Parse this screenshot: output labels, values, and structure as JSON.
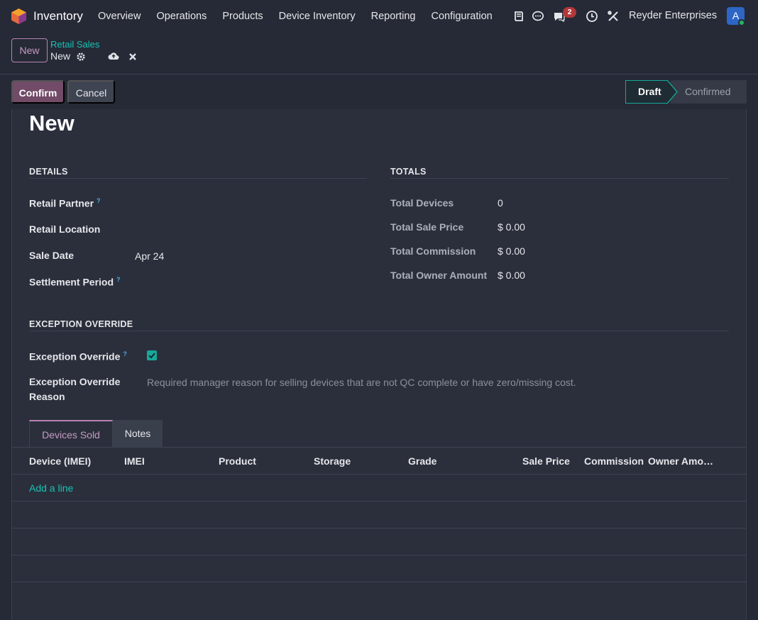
{
  "navbar": {
    "app_name": "Inventory",
    "menu": [
      "Overview",
      "Operations",
      "Products",
      "Device Inventory",
      "Reporting",
      "Configuration"
    ],
    "messages_badge": "2",
    "company": "Reyder Enterprises",
    "avatar_letter": "A"
  },
  "control_panel": {
    "new_label": "New",
    "breadcrumb": "Retail Sales",
    "record_name": "New"
  },
  "statusbar": {
    "confirm_label": "Confirm",
    "cancel_label": "Cancel",
    "stages": [
      "Draft",
      "Confirmed"
    ],
    "current_stage": "Draft"
  },
  "form": {
    "title": "New",
    "details": {
      "heading": "DETAILS",
      "retail_partner_label": "Retail Partner",
      "retail_location_label": "Retail Location",
      "sale_date_label": "Sale Date",
      "sale_date_value": "Apr 24",
      "settlement_period_label": "Settlement Period",
      "help_mark": "?"
    },
    "totals": {
      "heading": "TOTALS",
      "total_devices_label": "Total Devices",
      "total_devices_value": "0",
      "total_sale_price_label": "Total Sale Price",
      "total_sale_price_value": "$ 0.00",
      "total_commission_label": "Total Commission",
      "total_commission_value": "$ 0.00",
      "total_owner_amount_label": "Total Owner Amount",
      "total_owner_amount_value": "$ 0.00"
    },
    "exception": {
      "heading": "EXCEPTION OVERRIDE",
      "override_label": "Exception Override",
      "override_checked": true,
      "reason_label_line1": "Exception Override",
      "reason_label_line2": "Reason",
      "reason_placeholder": "Required manager reason for selling devices that are not QC complete or have zero/missing cost."
    }
  },
  "tabs": [
    "Devices Sold",
    "Notes"
  ],
  "table": {
    "columns": [
      "Device (IMEI)",
      "IMEI",
      "Product",
      "Storage",
      "Grade",
      "Sale Price",
      "Commission",
      "Owner Amo…"
    ],
    "add_line_label": "Add a line"
  },
  "colors": {
    "accent": "#714b67",
    "teal": "#16c3b3",
    "background": "#262a36"
  }
}
